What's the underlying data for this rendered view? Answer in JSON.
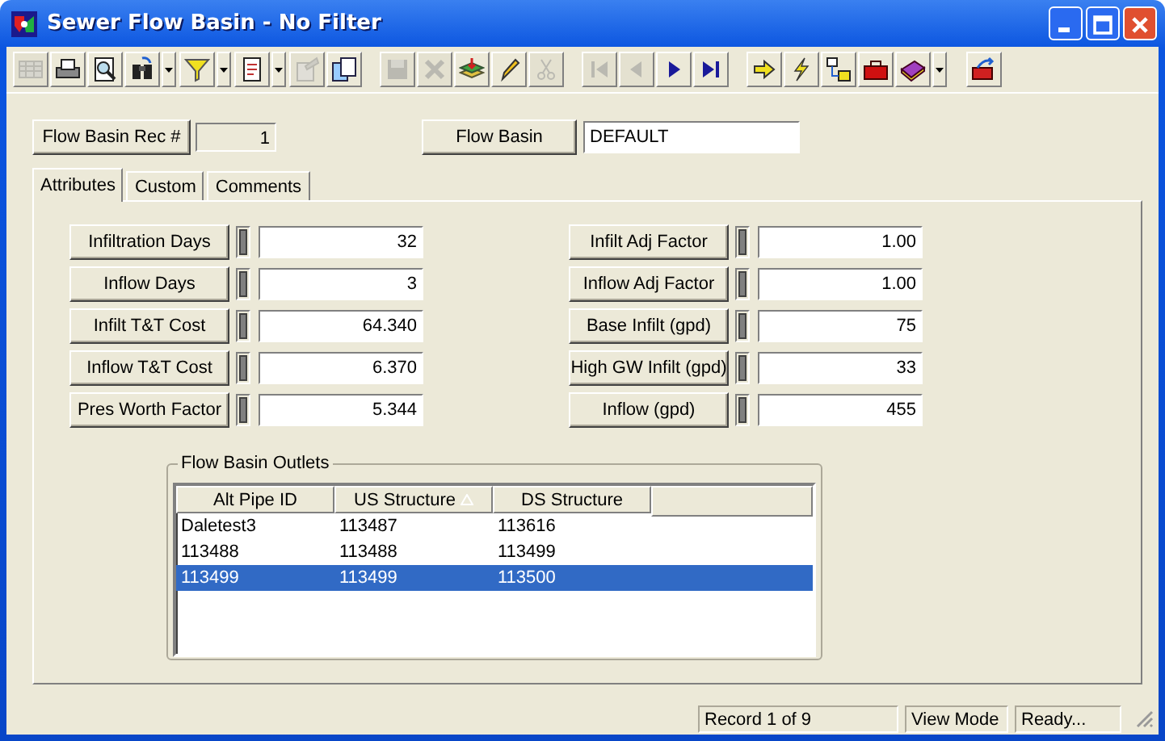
{
  "window": {
    "title": "Sewer Flow Basin - No Filter"
  },
  "toolbar": [
    {
      "kind": "grid",
      "disabled": true,
      "dropdown": false,
      "group_start": false
    },
    {
      "kind": "print",
      "disabled": false,
      "dropdown": false,
      "group_start": false
    },
    {
      "kind": "preview",
      "disabled": false,
      "dropdown": false,
      "group_start": false
    },
    {
      "kind": "binoculars",
      "disabled": false,
      "dropdown": true,
      "group_start": false
    },
    {
      "kind": "filter",
      "disabled": false,
      "dropdown": true,
      "group_start": false
    },
    {
      "kind": "report",
      "disabled": false,
      "dropdown": true,
      "group_start": false
    },
    {
      "kind": "document",
      "disabled": true,
      "dropdown": false,
      "group_start": false
    },
    {
      "kind": "copy",
      "disabled": false,
      "dropdown": false,
      "group_start": false
    },
    {
      "kind": "save",
      "disabled": true,
      "dropdown": false,
      "group_start": true
    },
    {
      "kind": "delete",
      "disabled": true,
      "dropdown": false,
      "group_start": false
    },
    {
      "kind": "stack",
      "disabled": false,
      "dropdown": false,
      "group_start": false
    },
    {
      "kind": "pencil",
      "disabled": false,
      "dropdown": false,
      "group_start": false
    },
    {
      "kind": "scissors",
      "disabled": true,
      "dropdown": false,
      "group_start": false
    },
    {
      "kind": "first",
      "disabled": true,
      "dropdown": false,
      "group_start": true
    },
    {
      "kind": "prev",
      "disabled": true,
      "dropdown": false,
      "group_start": false
    },
    {
      "kind": "next",
      "disabled": false,
      "dropdown": false,
      "group_start": false
    },
    {
      "kind": "last",
      "disabled": false,
      "dropdown": false,
      "group_start": false
    },
    {
      "kind": "arrow",
      "disabled": false,
      "dropdown": false,
      "group_start": true
    },
    {
      "kind": "lightning",
      "disabled": false,
      "dropdown": false,
      "group_start": false
    },
    {
      "kind": "tree",
      "disabled": false,
      "dropdown": false,
      "group_start": false
    },
    {
      "kind": "toolbox",
      "disabled": false,
      "dropdown": false,
      "group_start": false
    },
    {
      "kind": "book",
      "disabled": false,
      "dropdown": true,
      "group_start": false
    },
    {
      "kind": "export",
      "disabled": false,
      "dropdown": false,
      "group_start": true
    }
  ],
  "header": {
    "rec_label": "Flow Basin Rec #",
    "rec_value": "1",
    "basin_label": "Flow Basin",
    "basin_value": "DEFAULT"
  },
  "tabs": [
    {
      "label": "Attributes",
      "selected": true
    },
    {
      "label": "Custom",
      "selected": false
    },
    {
      "label": "Comments",
      "selected": false
    }
  ],
  "attributes_left": [
    {
      "label": "Infiltration Days",
      "value": "32"
    },
    {
      "label": "Inflow Days",
      "value": "3"
    },
    {
      "label": "Infilt T&T Cost",
      "value": "64.340"
    },
    {
      "label": "Inflow T&T Cost",
      "value": "6.370"
    },
    {
      "label": "Pres Worth Factor",
      "value": "5.344"
    }
  ],
  "attributes_right": [
    {
      "label": "Infilt Adj Factor",
      "value": "1.00"
    },
    {
      "label": "Inflow Adj Factor",
      "value": "1.00"
    },
    {
      "label": "Base Infilt (gpd)",
      "value": "75"
    },
    {
      "label": "High GW Infilt (gpd)",
      "value": "33"
    },
    {
      "label": "Inflow (gpd)",
      "value": "455"
    }
  ],
  "outlets": {
    "title": "Flow Basin Outlets",
    "columns": [
      {
        "label": "Alt Pipe ID",
        "sorted": false
      },
      {
        "label": "US Structure",
        "sorted": true
      },
      {
        "label": "DS Structure",
        "sorted": false
      }
    ],
    "rows": [
      {
        "cells": [
          "Daletest3",
          "113487",
          "113616"
        ],
        "selected": false
      },
      {
        "cells": [
          "113488",
          "113488",
          "113499"
        ],
        "selected": false
      },
      {
        "cells": [
          "113499",
          "113499",
          "113500"
        ],
        "selected": true
      }
    ]
  },
  "status_bar": [
    "Record 1 of 9",
    "View Mode",
    "Ready..."
  ]
}
